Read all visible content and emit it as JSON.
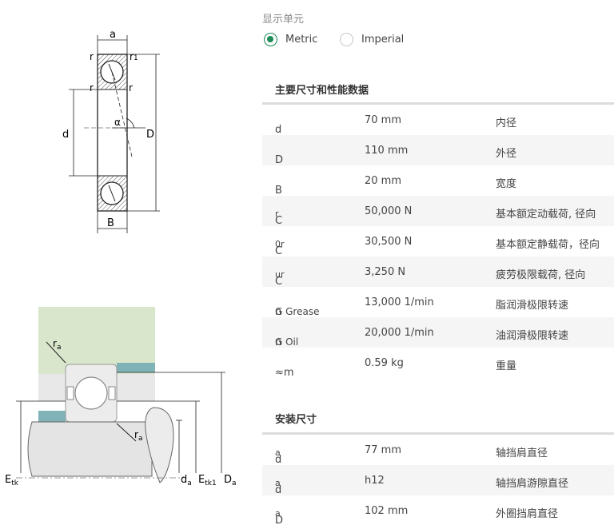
{
  "units": {
    "label": "显示单元",
    "options": [
      {
        "label": "Metric",
        "selected": true
      },
      {
        "label": "Imperial",
        "selected": false
      }
    ]
  },
  "main_section": {
    "title": "主要尺寸和性能数据",
    "rows": [
      {
        "sym": "d",
        "sub": "",
        "value": "70 mm",
        "desc": "内径"
      },
      {
        "sym": "D",
        "sub": "",
        "value": "110 mm",
        "desc": "外径"
      },
      {
        "sym": "B",
        "sub": "",
        "value": "20 mm",
        "desc": "宽度"
      },
      {
        "sym": "C",
        "sub": "r",
        "value": "50,000 N",
        "desc": "基本额定动载荷, 径向"
      },
      {
        "sym": "C",
        "sub": "0r",
        "value": "30,500 N",
        "desc": "基本额定静载荷，径向"
      },
      {
        "sym": "C",
        "sub": "ur",
        "value": "3,250 N",
        "desc": "疲劳极限载荷, 径向"
      },
      {
        "sym": "n",
        "sub": "G Grease",
        "value": "13,000 1/min",
        "desc": "脂润滑极限转速"
      },
      {
        "sym": "n",
        "sub": "G Oil",
        "value": "20,000 1/min",
        "desc": "油润滑极限转速"
      },
      {
        "sym": "≈m",
        "sub": "",
        "value": "0.59 kg",
        "desc": "重量"
      }
    ]
  },
  "mount_section": {
    "title": "安装尺寸",
    "rows": [
      {
        "sym": "d",
        "sub": "a",
        "value": "77 mm",
        "desc": "轴挡肩直径"
      },
      {
        "sym": "d",
        "sub": "a",
        "value": "h12",
        "desc": "轴挡肩游隙直径"
      },
      {
        "sym": "D",
        "sub": "a",
        "value": "102 mm",
        "desc": "外圈挡肩直径"
      }
    ]
  },
  "diagram_top": {
    "labels": {
      "a": "a",
      "r": "r",
      "r1": "r",
      "r1_sub": "1",
      "d": "d",
      "D": "D",
      "B": "B",
      "alpha": "α"
    }
  },
  "diagram_bottom": {
    "labels": {
      "ra": "r",
      "ra_sub": "a",
      "etk": "E",
      "etk_sub": "tk",
      "da": "d",
      "da_sub": "a",
      "etk1": "E",
      "etk1_sub": "tk1",
      "Da": "D",
      "Da_sub": "a"
    }
  },
  "colors": {
    "accent": "#1b8c55",
    "housing": "#d9e6cc",
    "shoulder": "#7fb3b8",
    "ring": "#e8e8e8"
  }
}
